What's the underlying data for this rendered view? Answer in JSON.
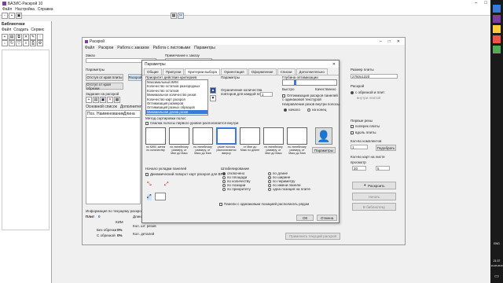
{
  "left_app": {
    "title": "БАЗИС-Раскрой 10",
    "menu": [
      "Файл",
      "Настройка",
      "Справка"
    ]
  },
  "library": {
    "title": "Библиотеки",
    "menu": [
      "Файл",
      "Создать",
      "Сервис"
    ]
  },
  "raskroy": {
    "title": "Раскрой",
    "menu": [
      "Файл",
      "Раскрои",
      "Работа с заказом",
      "Работа с листовыми",
      "Параметры"
    ],
    "zakaz_label": "Заказ",
    "prim_label": "Примечание к заказу",
    "material_label": "Материал",
    "params_label": "Параметры",
    "otstup1": "Отступ от края плиты",
    "otstup2": "Отступ от края обрезки",
    "raskroy_btn": "Раскрой",
    "zadanie_label": "Задание на раскрой",
    "sub_tabs": [
      "Основной список",
      "Дополнительный список"
    ],
    "table_headers": [
      "Поз.",
      "Наименование",
      "Длина"
    ],
    "info_label": "Информация по текущему раскрою",
    "plit": "Плит",
    "plit_val": "0",
    "kim": "КИМ",
    "dlina_kroya": "Длина кроя",
    "bez_obrezki": "Без обрезки",
    "bez_obrezki_val": "0%",
    "s_obrezkoy": "С обрезкой",
    "s_obrezkoy_val": "0%",
    "kol_rezov": "Кол. шт. резов",
    "kol_detaley": "Кол. деталей",
    "primenit": "Применить текущий раскрой"
  },
  "right_panel": {
    "razmer_label": "Размер плиты",
    "razmer_val": "2750x1220",
    "raskroy_label": "Раскрой",
    "s_obrezkoy": "с обрезкой и плит",
    "vnutri": "внутри плитой",
    "pervye_rezy": "Первые резы",
    "poperek": "поперек плиты",
    "vdol": "вдоль плиты",
    "kolvo_kompl": "Кол-во комплектов",
    "kolvo_val": "1",
    "podobrat": "Подобрать",
    "kolvo_kart": "Кол-во карт на листе",
    "prosmotr": "просмотр",
    "val_a": "20",
    "val_b": "5",
    "raskroit": "Раскроить",
    "nachat": "Начать",
    "v_biblioteku": "В библиотеку"
  },
  "dialog": {
    "title": "Параметры",
    "tabs": [
      "Общие",
      "Припуски",
      "Критерии выбора",
      "Ориентация",
      "Оформление",
      "Списки",
      "Дополнительно"
    ],
    "priority_label": "Приоритет действия критериев",
    "criteria": [
      "Максимальный КИМ",
      "Количество остатков разнородных",
      "Количество остатков",
      "Минимальное количество резов",
      "Количество карт раскроя",
      "Оптимизация размеров",
      "Оптимизация разных образцов",
      "Минимальная длина резов"
    ],
    "selected_index": 7,
    "params_label": "Параметры",
    "ogranichenie": "Ограничение количества повторов для каждой панели",
    "ogranichenie_val": "1",
    "glubina": "Глубина оптимизации",
    "bystro": "Быстро",
    "kachestvenno": "Качественно",
    "opt_checkbox": "Оптимизация раскроя панелей с одинаковой текстурой",
    "napravlenie": "Направление резов внутри полосы",
    "nachalo": "начало",
    "na_konec": "на конец",
    "metod_label": "Метод сортировки полос",
    "metod_checkbox": "Свалка полосы первого уровня располагается внутри",
    "methods": [
      "по КИМ, затем по количеству",
      "по линейному размеру, от Мин до Макс",
      "по линейному размеру, от Макс до Мин",
      "узкие полосы располагаются вверху",
      "от Мин до Макс по длине",
      "по линейному размеру, от Мин до Макс",
      "по линейному размеру, от Макс до Мин"
    ],
    "parametry_btn": "Параметры",
    "nachalo_ukl": "Начало укладки панелей",
    "dinam_checkbox": "Динамический поворот карт раскроя для ВРС",
    "shtabel_label": "Штабелирование",
    "shtabel_left": [
      "отключено",
      "по площади",
      "по количеству",
      "по позиции",
      "по приоритету"
    ],
    "shtabel_right": [
      "по длине",
      "по ширине",
      "по периметру",
      "по имени панели",
      "одна позиция на плите"
    ],
    "paneli_checkbox": "Панели с одинаковым позицией располагать рядом",
    "ok": "ОК",
    "otmena": "Отмена"
  },
  "taskbar": {
    "lang": "ENG",
    "time": "21:37",
    "date": "16.08.2018"
  },
  "colors": {
    "selection": "#3a7bd5",
    "app_icon": "#7b3fa0"
  }
}
